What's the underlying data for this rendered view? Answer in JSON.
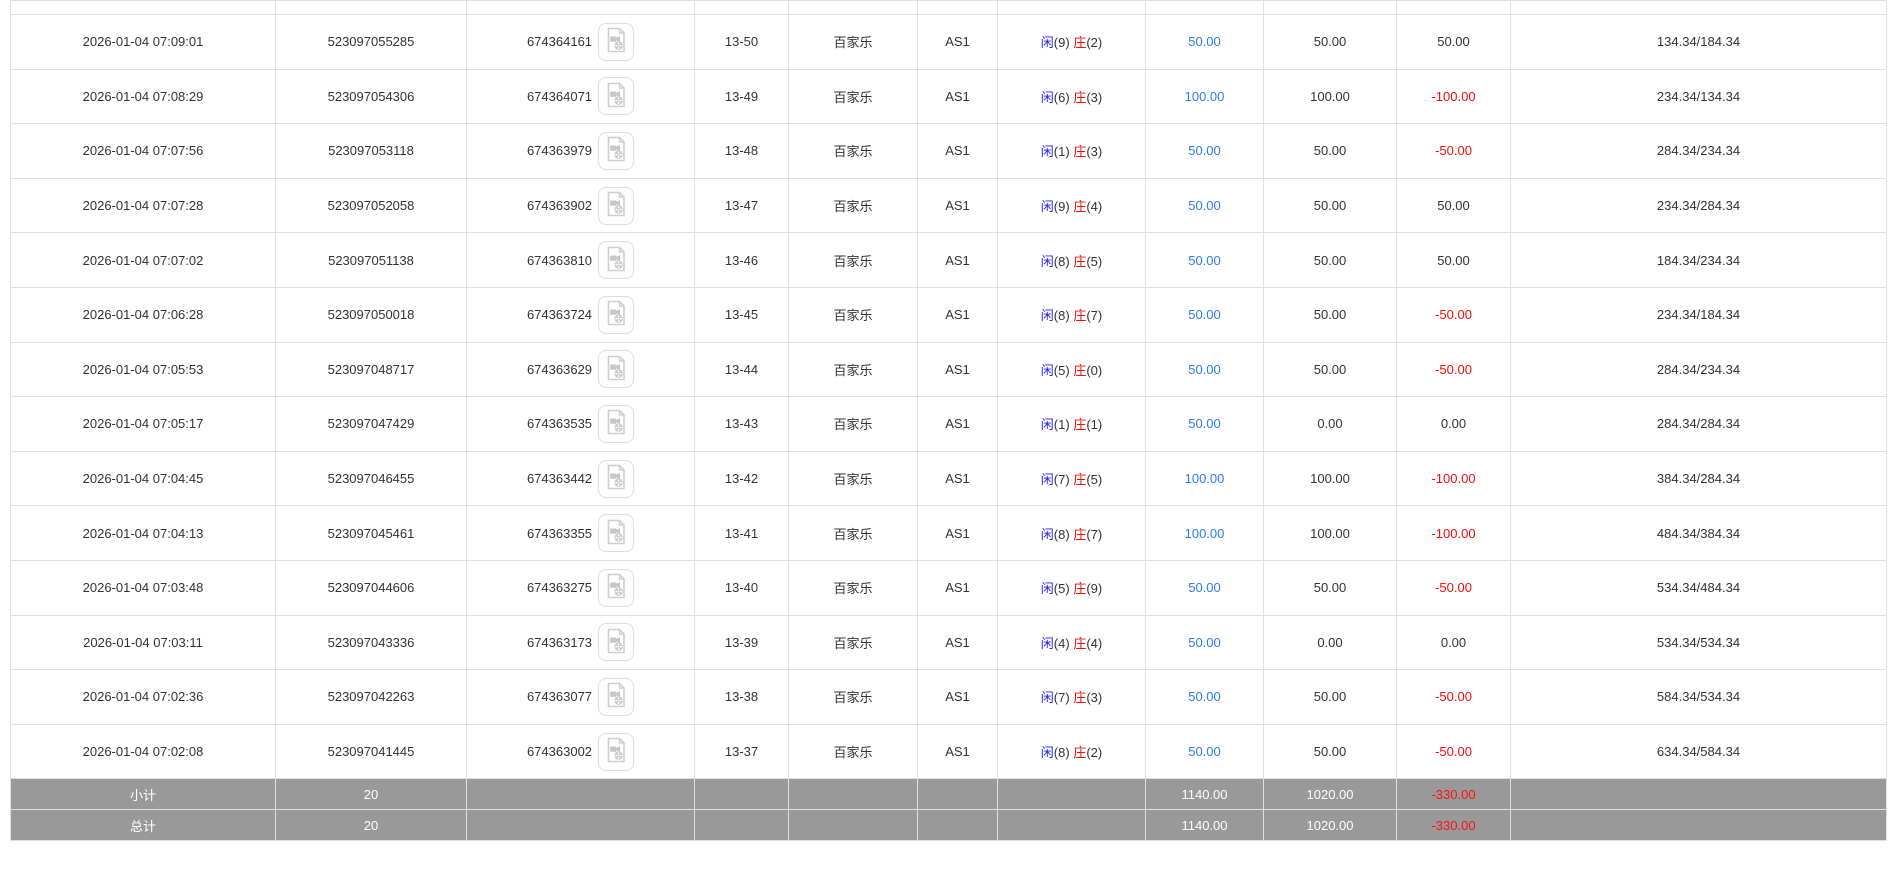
{
  "ui": {
    "video_icon": "video-replay",
    "colors": {
      "link_blue": "#2e7bf0",
      "player_blue": "#2222ee",
      "banker_red": "#f30c0c",
      "negative_red": "#f30c0c",
      "footer_gray": "#999999",
      "row_border": "#e0e0e0",
      "text": "#333333"
    }
  },
  "rows": [
    {
      "time": "2026-01-04 07:09:01",
      "order_no": "523097055285",
      "session_no": "674364161",
      "round": "13-50",
      "game": "百家乐",
      "table": "AS1",
      "player_label": "闲",
      "player_score": "(9)",
      "banker_label": "庄",
      "banker_score": "(2)",
      "bet": "50.00",
      "valid": "50.00",
      "winloss": "50.00",
      "balance": "134.34/184.34"
    },
    {
      "time": "2026-01-04 07:08:29",
      "order_no": "523097054306",
      "session_no": "674364071",
      "round": "13-49",
      "game": "百家乐",
      "table": "AS1",
      "player_label": "闲",
      "player_score": "(6)",
      "banker_label": "庄",
      "banker_score": "(3)",
      "bet": "100.00",
      "valid": "100.00",
      "winloss": "-100.00",
      "balance": "234.34/134.34"
    },
    {
      "time": "2026-01-04 07:07:56",
      "order_no": "523097053118",
      "session_no": "674363979",
      "round": "13-48",
      "game": "百家乐",
      "table": "AS1",
      "player_label": "闲",
      "player_score": "(1)",
      "banker_label": "庄",
      "banker_score": "(3)",
      "bet": "50.00",
      "valid": "50.00",
      "winloss": "-50.00",
      "balance": "284.34/234.34"
    },
    {
      "time": "2026-01-04 07:07:28",
      "order_no": "523097052058",
      "session_no": "674363902",
      "round": "13-47",
      "game": "百家乐",
      "table": "AS1",
      "player_label": "闲",
      "player_score": "(9)",
      "banker_label": "庄",
      "banker_score": "(4)",
      "bet": "50.00",
      "valid": "50.00",
      "winloss": "50.00",
      "balance": "234.34/284.34"
    },
    {
      "time": "2026-01-04 07:07:02",
      "order_no": "523097051138",
      "session_no": "674363810",
      "round": "13-46",
      "game": "百家乐",
      "table": "AS1",
      "player_label": "闲",
      "player_score": "(8)",
      "banker_label": "庄",
      "banker_score": "(5)",
      "bet": "50.00",
      "valid": "50.00",
      "winloss": "50.00",
      "balance": "184.34/234.34"
    },
    {
      "time": "2026-01-04 07:06:28",
      "order_no": "523097050018",
      "session_no": "674363724",
      "round": "13-45",
      "game": "百家乐",
      "table": "AS1",
      "player_label": "闲",
      "player_score": "(8)",
      "banker_label": "庄",
      "banker_score": "(7)",
      "bet": "50.00",
      "valid": "50.00",
      "winloss": "-50.00",
      "balance": "234.34/184.34"
    },
    {
      "time": "2026-01-04 07:05:53",
      "order_no": "523097048717",
      "session_no": "674363629",
      "round": "13-44",
      "game": "百家乐",
      "table": "AS1",
      "player_label": "闲",
      "player_score": "(5)",
      "banker_label": "庄",
      "banker_score": "(0)",
      "bet": "50.00",
      "valid": "50.00",
      "winloss": "-50.00",
      "balance": "284.34/234.34"
    },
    {
      "time": "2026-01-04 07:05:17",
      "order_no": "523097047429",
      "session_no": "674363535",
      "round": "13-43",
      "game": "百家乐",
      "table": "AS1",
      "player_label": "闲",
      "player_score": "(1)",
      "banker_label": "庄",
      "banker_score": "(1)",
      "bet": "50.00",
      "valid": "0.00",
      "winloss": "0.00",
      "balance": "284.34/284.34"
    },
    {
      "time": "2026-01-04 07:04:45",
      "order_no": "523097046455",
      "session_no": "674363442",
      "round": "13-42",
      "game": "百家乐",
      "table": "AS1",
      "player_label": "闲",
      "player_score": "(7)",
      "banker_label": "庄",
      "banker_score": "(5)",
      "bet": "100.00",
      "valid": "100.00",
      "winloss": "-100.00",
      "balance": "384.34/284.34"
    },
    {
      "time": "2026-01-04 07:04:13",
      "order_no": "523097045461",
      "session_no": "674363355",
      "round": "13-41",
      "game": "百家乐",
      "table": "AS1",
      "player_label": "闲",
      "player_score": "(8)",
      "banker_label": "庄",
      "banker_score": "(7)",
      "bet": "100.00",
      "valid": "100.00",
      "winloss": "-100.00",
      "balance": "484.34/384.34"
    },
    {
      "time": "2026-01-04 07:03:48",
      "order_no": "523097044606",
      "session_no": "674363275",
      "round": "13-40",
      "game": "百家乐",
      "table": "AS1",
      "player_label": "闲",
      "player_score": "(5)",
      "banker_label": "庄",
      "banker_score": "(9)",
      "bet": "50.00",
      "valid": "50.00",
      "winloss": "-50.00",
      "balance": "534.34/484.34"
    },
    {
      "time": "2026-01-04 07:03:11",
      "order_no": "523097043336",
      "session_no": "674363173",
      "round": "13-39",
      "game": "百家乐",
      "table": "AS1",
      "player_label": "闲",
      "player_score": "(4)",
      "banker_label": "庄",
      "banker_score": "(4)",
      "bet": "50.00",
      "valid": "0.00",
      "winloss": "0.00",
      "balance": "534.34/534.34"
    },
    {
      "time": "2026-01-04 07:02:36",
      "order_no": "523097042263",
      "session_no": "674363077",
      "round": "13-38",
      "game": "百家乐",
      "table": "AS1",
      "player_label": "闲",
      "player_score": "(7)",
      "banker_label": "庄",
      "banker_score": "(3)",
      "bet": "50.00",
      "valid": "50.00",
      "winloss": "-50.00",
      "balance": "584.34/534.34"
    },
    {
      "time": "2026-01-04 07:02:08",
      "order_no": "523097041445",
      "session_no": "674363002",
      "round": "13-37",
      "game": "百家乐",
      "table": "AS1",
      "player_label": "闲",
      "player_score": "(8)",
      "banker_label": "庄",
      "banker_score": "(2)",
      "bet": "50.00",
      "valid": "50.00",
      "winloss": "-50.00",
      "balance": "634.34/584.34"
    }
  ],
  "footer": {
    "subtotal": {
      "label": "小计",
      "count": "20",
      "bet": "1140.00",
      "valid": "1020.00",
      "winloss": "-330.00"
    },
    "total": {
      "label": "总计",
      "count": "20",
      "bet": "1140.00",
      "valid": "1020.00",
      "winloss": "-330.00"
    }
  }
}
